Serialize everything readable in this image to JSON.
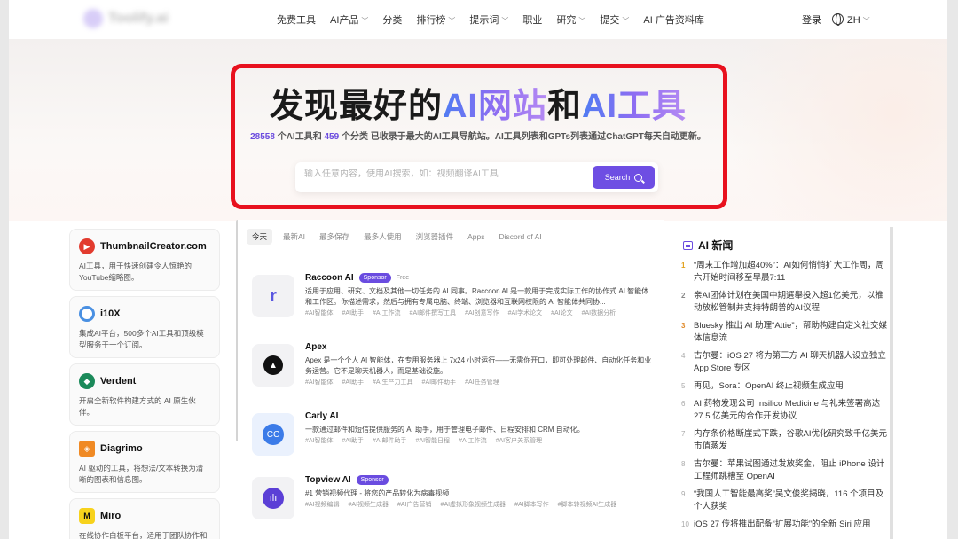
{
  "nav": {
    "logo_text": "Toolify.ai",
    "links": [
      {
        "label": "免费工具",
        "dropdown": false
      },
      {
        "label": "AI产品",
        "dropdown": true
      },
      {
        "label": "分类",
        "dropdown": false
      },
      {
        "label": "排行榜",
        "dropdown": true
      },
      {
        "label": "提示词",
        "dropdown": true
      },
      {
        "label": "职业",
        "dropdown": false
      },
      {
        "label": "研究",
        "dropdown": true
      },
      {
        "label": "提交",
        "dropdown": true
      },
      {
        "label": "AI 广告资料库",
        "dropdown": false
      }
    ],
    "login": "登录",
    "lang": "ZH"
  },
  "hero": {
    "title_plain1": "发现最好的",
    "title_grad1": "AI网站",
    "title_plain2": "和",
    "title_grad2": "AI工具",
    "count_tools": "28558",
    "sub_part1": " 个AI工具和 ",
    "count_categories": "459",
    "sub_part2": " 个分类 已收录于最大的AI工具导航站。AI工具列表和GPTs列表通过ChatGPT每天自动更新。",
    "search_placeholder": "输入任意内容，使用AI搜索，如：视频翻译AI工具",
    "search_button": "Search"
  },
  "sidebar": [
    {
      "name": "ThumbnailCreator.com",
      "desc": "AI工具，用于快速创建令人惊艳的YouTube缩略图。",
      "icon": "play-icon",
      "color": "#e23b2e"
    },
    {
      "name": "i10X",
      "desc": "集成AI平台，500多个AI工具和顶级模型服务于一个订阅。",
      "icon": "circle-icon",
      "color": "#4a90e2"
    },
    {
      "name": "Verdent",
      "desc": "开启全新软件构建方式的 AI 原生伙伴。",
      "icon": "leaf-icon",
      "color": "#1b8a5a"
    },
    {
      "name": "Diagrimo",
      "desc": "AI 驱动的工具，将想法/文本转换为清晰的图表和信息图。",
      "icon": "cube-icon",
      "color": "#f08a24"
    },
    {
      "name": "Miro",
      "desc": "在线协作白板平台，适用于团队协作和",
      "icon": "miro-icon",
      "color": "#f7d21c"
    }
  ],
  "tabs": [
    "今天",
    "最新AI",
    "最多保存",
    "最多人使用",
    "浏览器插件",
    "Apps",
    "Discord of AI"
  ],
  "tools": [
    {
      "name": "Raccoon AI",
      "sponsor": "Sponsor",
      "free": "Free",
      "desc": "适用于应用、研究、文档及其他一切任务的 AI 同事。Raccoon AI 是一款用于完成实际工作的协作式 AI 智能体和工作区。你描述需求，然后与拥有专属电脑、终端、浏览器和互联网权限的 AI 智能体共同协...",
      "tags": [
        "#AI智能体",
        "#AI助手",
        "#AI工作流",
        "#AI邮件撰写工具",
        "#AI创意写作",
        "#AI学术论文",
        "#AI论文",
        "#AI数据分析"
      ]
    },
    {
      "name": "Apex",
      "sponsor": "",
      "free": "",
      "desc": "Apex 是一个个人 AI 智能体，在专用服务器上 7x24 小时运行——无需你开口，即可处理邮件、自动化任务和业务运营。它不是聊天机器人，而是基础设施。",
      "tags": [
        "#AI智能体",
        "#AI助手",
        "#AI生产力工具",
        "#AI邮件助手",
        "#AI任务管理"
      ]
    },
    {
      "name": "Carly AI",
      "sponsor": "",
      "free": "",
      "desc": "一款通过邮件和短信提供服务的 AI 助手，用于管理电子邮件、日程安排和 CRM 自动化。",
      "tags": [
        "#AI智能体",
        "#AI助手",
        "#AI邮件助手",
        "#AI智能日程",
        "#AI工作流",
        "#AI客户关系管理"
      ]
    },
    {
      "name": "Topview AI",
      "sponsor": "Sponsor",
      "free": "",
      "desc": "#1 营销视频代理 - 将您的产品转化为病毒视频",
      "tags": [
        "#AI视频编辑",
        "#AI视频生成器",
        "#AI广告营销",
        "#AI虚拟形象视频生成器",
        "#AI脚本写作",
        "#脚本转视频AI生成器"
      ]
    }
  ],
  "news": {
    "title": "AI 新闻",
    "items": [
      {
        "n": "1",
        "text": "“周末工作增加超40%”：AI如何悄悄扩大工作周，周六开始时间移至早晨7:11"
      },
      {
        "n": "2",
        "text": "亲AI团体计划在美国中期選舉投入超1亿美元，以推动放松管制并支持特朗普的AI议程"
      },
      {
        "n": "3",
        "text": "Bluesky 推出 AI 助理“Attie”，帮助构建自定义社交媒体信息流"
      },
      {
        "n": "4",
        "text": "古尔曼：iOS 27 将为第三方 AI 聊天机器人设立独立 App Store 专区"
      },
      {
        "n": "5",
        "text": "再见，Sora：OpenAI 终止视频生成应用"
      },
      {
        "n": "6",
        "text": "AI 药物发现公司 Insilico Medicine 与礼来签署高达 27.5 亿美元的合作开发协议"
      },
      {
        "n": "7",
        "text": "内存条价格断崖式下跌，谷歌AI优化研究致千亿美元市值蒸发"
      },
      {
        "n": "8",
        "text": "古尔曼：苹果试图通过发放奖金，阻止 iPhone 设计工程师跳槽至 OpenAI"
      },
      {
        "n": "9",
        "text": "“我国人工智能最高奖”吴文俊奖揭晓，116 个项目及个人获奖"
      },
      {
        "n": "10",
        "text": "iOS 27 传将推出配备“扩展功能”的全新 Siri 应用"
      }
    ]
  }
}
